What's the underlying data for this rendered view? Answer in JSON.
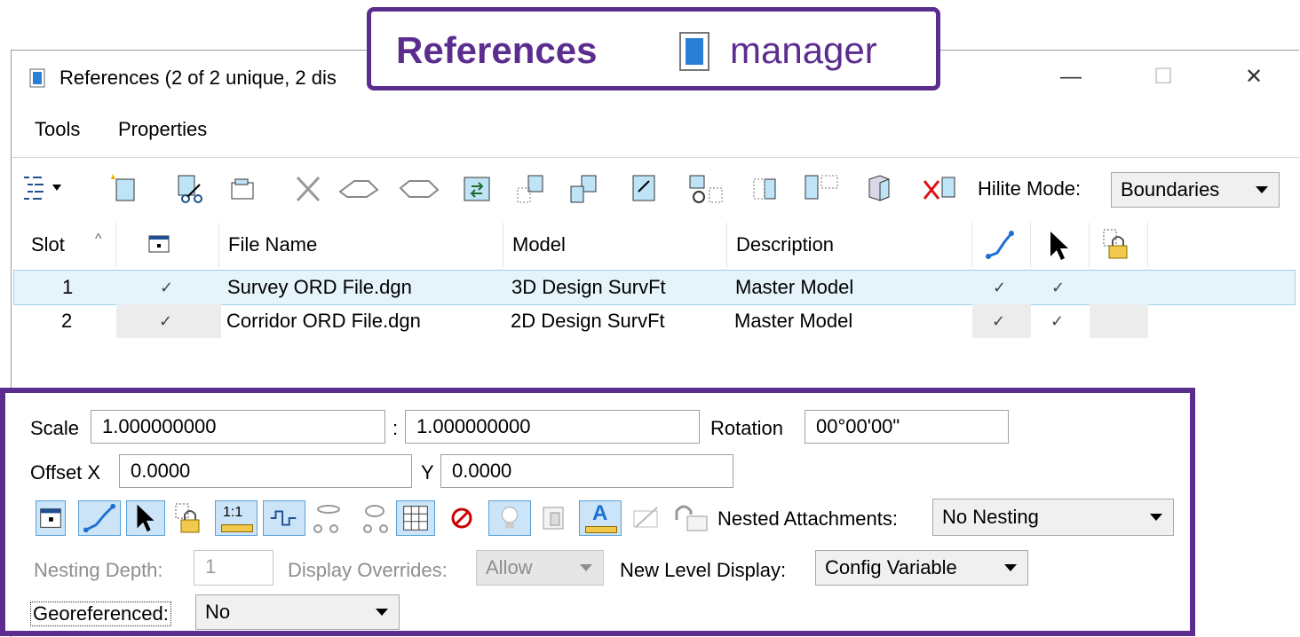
{
  "banner": {
    "bold": "References",
    "rest": "manager"
  },
  "window": {
    "title": "References (2 of 2 unique, 2 dis",
    "minimize": "—",
    "maximize": "☐",
    "close": "✕"
  },
  "menu": {
    "tools": "Tools",
    "properties": "Properties"
  },
  "toolbar": {
    "hilite_label": "Hilite Mode:",
    "hilite_value": "Boundaries"
  },
  "grid": {
    "headers": {
      "slot": "Slot",
      "file_name": "File Name",
      "model": "Model",
      "description": "Description"
    },
    "rows": [
      {
        "slot": "1",
        "file": "Survey ORD File.dgn",
        "model": "3D Design SurvFt",
        "description": "Master Model"
      },
      {
        "slot": "2",
        "file": "Corridor ORD File.dgn",
        "model": "2D Design SurvFt",
        "description": "Master Model"
      }
    ],
    "check": "✓"
  },
  "props": {
    "scale_label": "Scale",
    "scale_a": "1.000000000",
    "colon": ":",
    "scale_b": "1.000000000",
    "rotation_label": "Rotation",
    "rotation_value": "00°00'00\"",
    "offset_x_label": "Offset X",
    "offset_x_value": "0.0000",
    "y_label": "Y",
    "offset_y_value": "0.0000",
    "nested_label": "Nested Attachments:",
    "nested_value": "No Nesting",
    "nesting_depth_label": "Nesting Depth:",
    "nesting_depth_value": "1",
    "display_overrides_label": "Display Overrides:",
    "display_overrides_value": "Allow",
    "new_level_label": "New Level Display:",
    "new_level_value": "Config Variable",
    "georef_label": "Georeferenced:",
    "georef_value": "No",
    "scale_icon_text": "1:1"
  },
  "colors": {
    "accent": "#5b2d8e",
    "selection": "#e5f3fb",
    "button_on": "#cce4f7"
  }
}
